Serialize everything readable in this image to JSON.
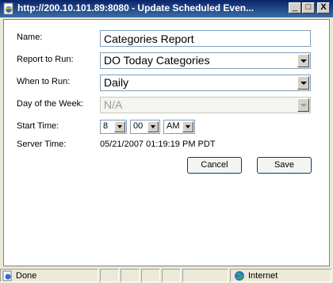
{
  "window": {
    "title": "http://200.10.101.89:8080 - Update Scheduled Even...",
    "minimize_label": "_",
    "maximize_label": "□",
    "close_label": "X"
  },
  "form": {
    "name_label": "Name:",
    "name_value": "Categories Report",
    "report_label": "Report to Run:",
    "report_value": "DO Today Categories",
    "when_label": "When to Run:",
    "when_value": "Daily",
    "day_label": "Day of the Week:",
    "day_value": "N/A",
    "start_label": "Start Time:",
    "start_hour": "8",
    "start_minute": "00",
    "start_ampm": "AM",
    "server_label": "Server Time:",
    "server_value": "05/21/2007 01:19:19 PM PDT"
  },
  "buttons": {
    "cancel": "Cancel",
    "save": "Save"
  },
  "status": {
    "text": "Done",
    "zone": "Internet"
  },
  "colors": {
    "title_bar": "#0a246a",
    "window_bg": "#ece9d8"
  }
}
